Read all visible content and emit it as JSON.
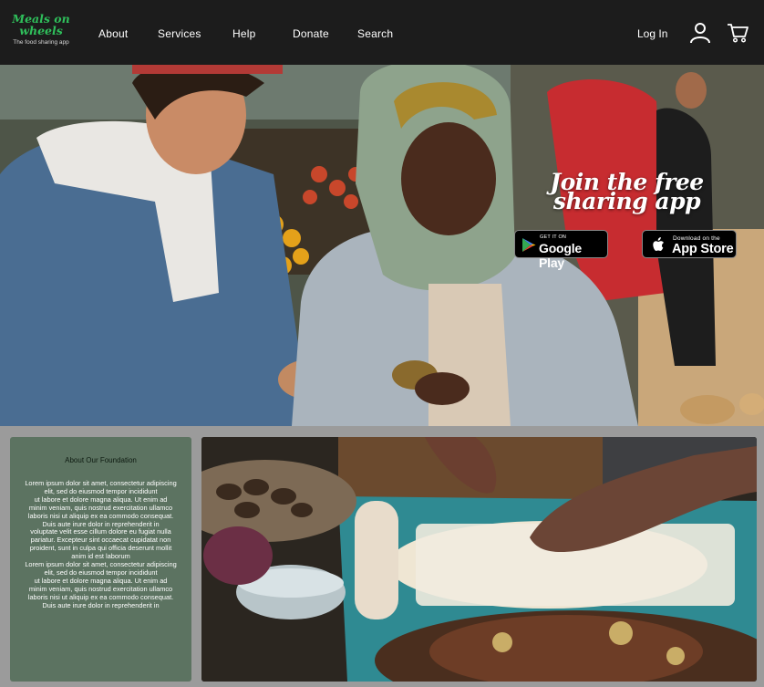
{
  "header": {
    "logo_title": "Meals on\nwheels",
    "logo_tagline": "The food sharing app",
    "nav": [
      {
        "label": "About"
      },
      {
        "label": "Services"
      },
      {
        "label": "Help"
      },
      {
        "label": "Donate"
      },
      {
        "label": "Search"
      }
    ],
    "login_label": "Log In",
    "icons": [
      "user-icon",
      "cart-icon"
    ]
  },
  "hero": {
    "title": "Join the free sharing app",
    "google_play": {
      "small": "GET IT ON",
      "big": "Google Play"
    },
    "app_store": {
      "small": "Download on the",
      "big": "App Store"
    }
  },
  "about": {
    "title": "About Our Foundation",
    "body": "Lorem ipsum dolor sit amet, consectetur adipiscing elit, sed do eiusmod tempor incididunt\nut labore et dolore magna aliqua. Ut enim ad minim veniam, quis nostrud exercitation ullamco\nlaboris nisi ut aliquip ex ea commodo consequat. Duis aute irure dolor in reprehenderit in\nvoluptate velit esse cillum dolore eu fugiat nulla pariatur. Excepteur sint occaecat cupidatat non\nproident, sunt in culpa qui officia deserunt mollit anim id est laborum\nLorem ipsum dolor sit amet, consectetur adipiscing elit, sed do eiusmod tempor incididunt\nut labore et dolore magna aliqua. Ut enim ad minim veniam, quis nostrud exercitation ullamco\nlaboris nisi ut aliquip ex ea commodo consequat. Duis aute irure dolor in reprehenderit in"
  },
  "colors": {
    "header_bg": "#1c1c1c",
    "logo_green": "#2fbf5b",
    "about_panel": "#5c7361",
    "page_bg": "#9b9b9b"
  }
}
